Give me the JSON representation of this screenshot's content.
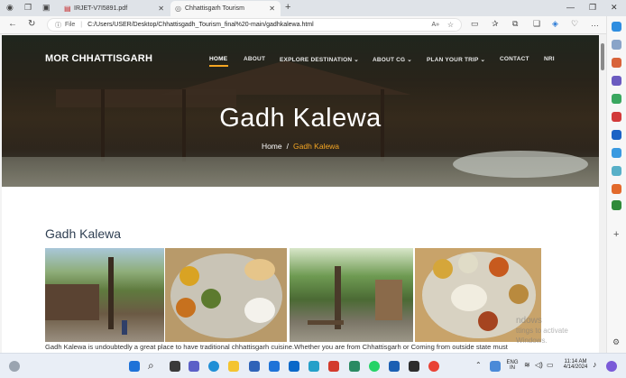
{
  "browser": {
    "tabs": [
      {
        "label": "IRJET-V7I5891.pdf"
      },
      {
        "label": "Chhattisgarh Tourism"
      }
    ],
    "address": {
      "prefix": "File",
      "url": "C:/Users/USER/Desktop/Chhattisgadh_Tourism_final%20-main/gadhkalewa.html"
    },
    "window_controls": {
      "minimize": "—",
      "maximize": "❐",
      "close": "✕"
    }
  },
  "site": {
    "brand": "MOR CHHATTISGARH",
    "nav": [
      {
        "label": "HOME"
      },
      {
        "label": "ABOUT"
      },
      {
        "label": "EXPLORE DESTINATION ⌄"
      },
      {
        "label": "ABOUT CG ⌄"
      },
      {
        "label": "PLAN YOUR TRIP ⌄"
      },
      {
        "label": "CONTACT"
      },
      {
        "label": "NRI"
      }
    ],
    "accent_color": "#f5a623",
    "hero": {
      "title": "Gadh Kalewa",
      "breadcrumb_home": "Home",
      "breadcrumb_sep": "/",
      "breadcrumb_current": "Gadh Kalewa"
    },
    "section_title": "Gadh Kalewa",
    "caption": "Gadh Kalewa is undoubtedly a great place to have traditional chhattisgarh cuisine.Whether you are from Chhattisgarh or Coming from outside state must"
  },
  "os": {
    "watermark_line1": "ndows",
    "watermark_line2": "ttings to activate Windows.",
    "lang_line1": "ENG",
    "lang_line2": "IN",
    "time": "11:14 AM",
    "date": "4/14/2024"
  }
}
